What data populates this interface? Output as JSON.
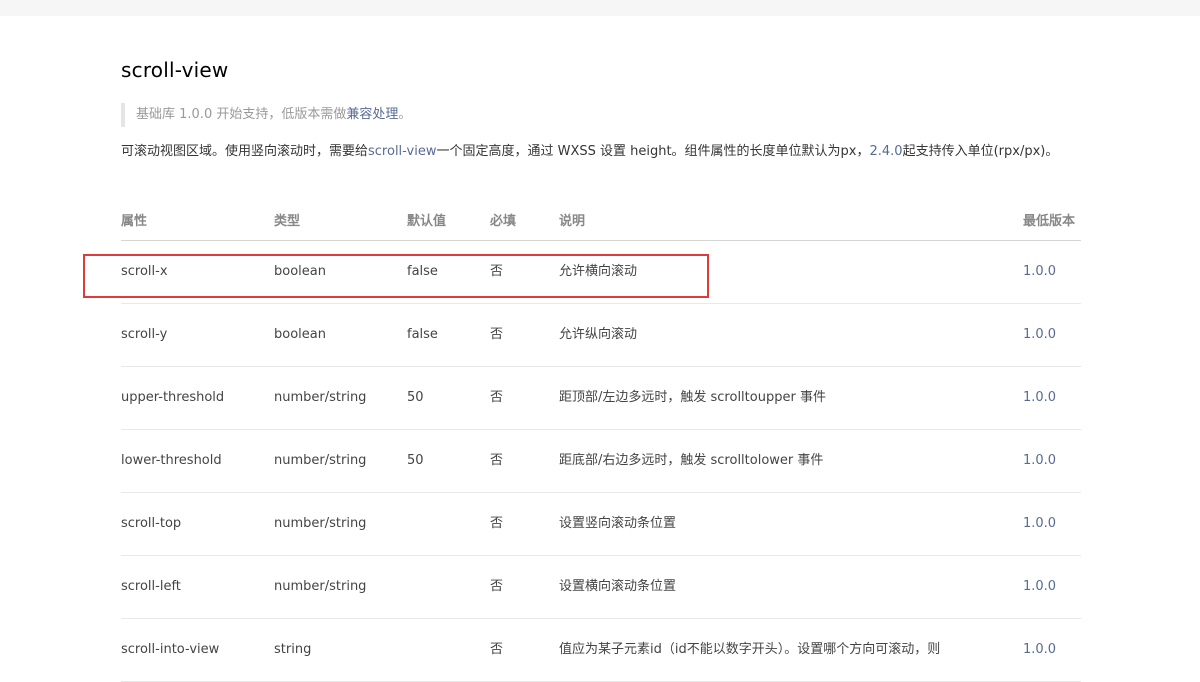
{
  "page": {
    "title": "scroll-view",
    "note": {
      "prefix": "基础库 1.0.0 开始支持，低版本需做",
      "link": "兼容处理",
      "suffix": "。"
    },
    "description": {
      "part1": "可滚动视图区域。使用竖向滚动时，需要给",
      "link1": "scroll-view",
      "part2": "一个固定高度，通过 WXSS 设置 height。组件属性的长度单位默认为px，",
      "link2": "2.4.0",
      "part3": "起支持传入单位(rpx/px)。"
    }
  },
  "table": {
    "headers": [
      "属性",
      "类型",
      "默认值",
      "必填",
      "说明",
      "最低版本"
    ],
    "rows": [
      {
        "attr": "scroll-x",
        "type": "boolean",
        "default": "false",
        "required": "否",
        "desc": "允许横向滚动",
        "version": "1.0.0"
      },
      {
        "attr": "scroll-y",
        "type": "boolean",
        "default": "false",
        "required": "否",
        "desc": "允许纵向滚动",
        "version": "1.0.0"
      },
      {
        "attr": "upper-threshold",
        "type": "number/string",
        "default": "50",
        "required": "否",
        "desc": "距顶部/左边多远时，触发 scrolltoupper 事件",
        "version": "1.0.0"
      },
      {
        "attr": "lower-threshold",
        "type": "number/string",
        "default": "50",
        "required": "否",
        "desc": "距底部/右边多远时，触发 scrolltolower 事件",
        "version": "1.0.0"
      },
      {
        "attr": "scroll-top",
        "type": "number/string",
        "default": "",
        "required": "否",
        "desc": "设置竖向滚动条位置",
        "version": "1.0.0"
      },
      {
        "attr": "scroll-left",
        "type": "number/string",
        "default": "",
        "required": "否",
        "desc": "设置横向滚动条位置",
        "version": "1.0.0"
      },
      {
        "attr": "scroll-into-view",
        "type": "string",
        "default": "",
        "required": "否",
        "desc": "值应为某子元素id（id不能以数字开头）。设置哪个方向可滚动，则",
        "version": "1.0.0"
      }
    ]
  },
  "colors": {
    "link": "#576b95",
    "highlight_border": "#e03b3b"
  }
}
